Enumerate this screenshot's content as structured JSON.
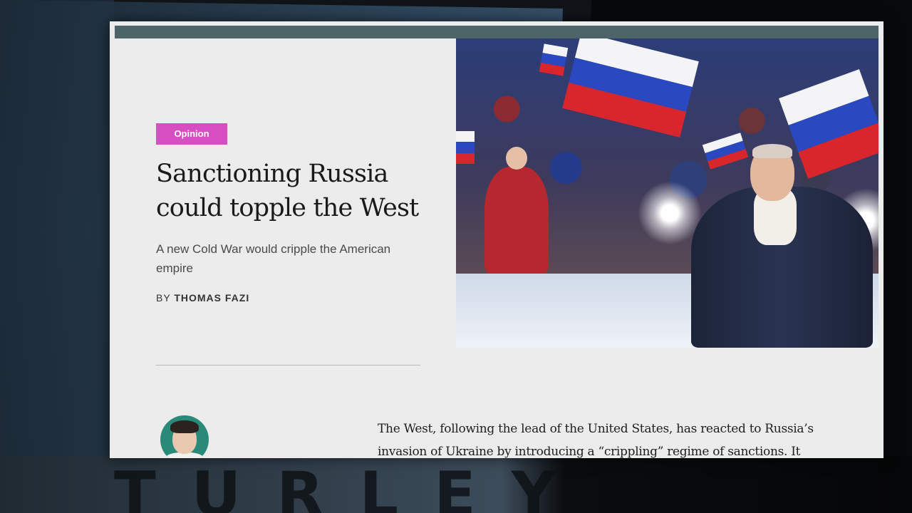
{
  "article": {
    "category_badge": "Opinion",
    "headline": "Sanctioning Russia could topple the West",
    "dek": "A new Cold War would cripple the American empire",
    "byline_prefix": "BY",
    "byline_author": "THOMAS FAZI",
    "body_first_paragraph": "The West, following the lead of the United States, has reacted to Russia’s invasion of Ukraine by introducing a “crippling” regime of sanctions. It"
  },
  "overlay": {
    "letters": [
      "T",
      "U",
      "R",
      "L",
      "E",
      "Y"
    ]
  },
  "colors": {
    "badge": "#d64ec0",
    "topbar": "#4d6468",
    "page_bg": "#ececec"
  }
}
